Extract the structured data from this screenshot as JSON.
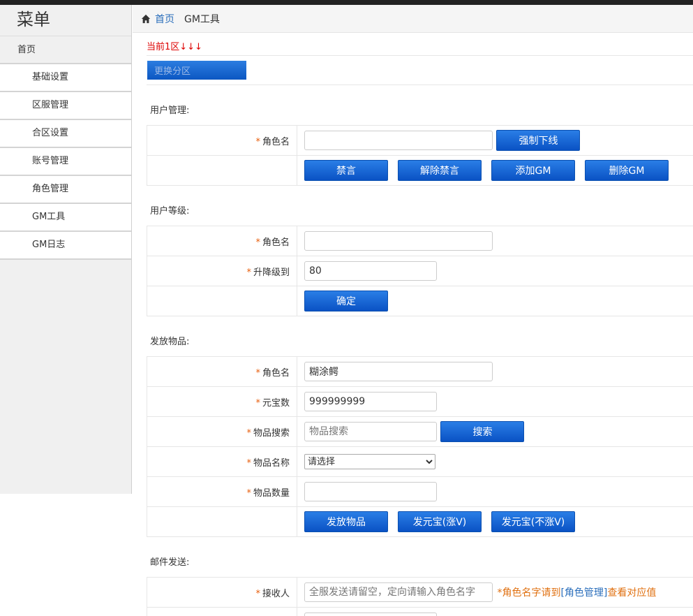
{
  "sidebar": {
    "title": "菜单",
    "home": "首页",
    "items": [
      "基础设置",
      "区服管理",
      "合区设置",
      "账号管理",
      "角色管理",
      "GM工具",
      "GM日志"
    ]
  },
  "breadcrumb": {
    "home": "首页",
    "current": "GM工具"
  },
  "zone": {
    "label": "当前1区↓↓↓",
    "change_button": "更换分区"
  },
  "user_mgmt": {
    "title": "用户管理:",
    "role_label": "角色名",
    "role_value": "",
    "force_offline": "强制下线",
    "mute": "禁言",
    "unmute": "解除禁言",
    "add_gm": "添加GM",
    "remove_gm": "删除GM"
  },
  "user_level": {
    "title": "用户等级:",
    "role_label": "角色名",
    "role_value": "",
    "level_label": "升降级到",
    "level_value": "80",
    "confirm": "确定"
  },
  "items": {
    "title": "发放物品:",
    "role_label": "角色名",
    "role_value": "糊涂鳄",
    "yuanbao_label": "元宝数",
    "yuanbao_value": "999999999",
    "search_label": "物品搜索",
    "search_placeholder": "物品搜索",
    "search_button": "搜索",
    "name_label": "物品名称",
    "name_selected": "请选择",
    "qty_label": "物品数量",
    "qty_value": "",
    "send_item": "发放物品",
    "send_yb_v": "发元宝(涨V)",
    "send_yb_nov": "发元宝(不涨V)"
  },
  "mail": {
    "title": "邮件发送:",
    "recipient_label": "接收人",
    "recipient_placeholder": "全服发送请留空，定向请输入角色名字",
    "hint_prefix": "*角色名字请到",
    "hint_link": "[角色管理]",
    "hint_suffix": "查看对应值"
  },
  "colors": {
    "accent": "#0a52c4",
    "required": "#e85e0c",
    "zone": "#dd0000",
    "link": "#2a6ebb"
  },
  "icons": {
    "home": "home-icon"
  }
}
